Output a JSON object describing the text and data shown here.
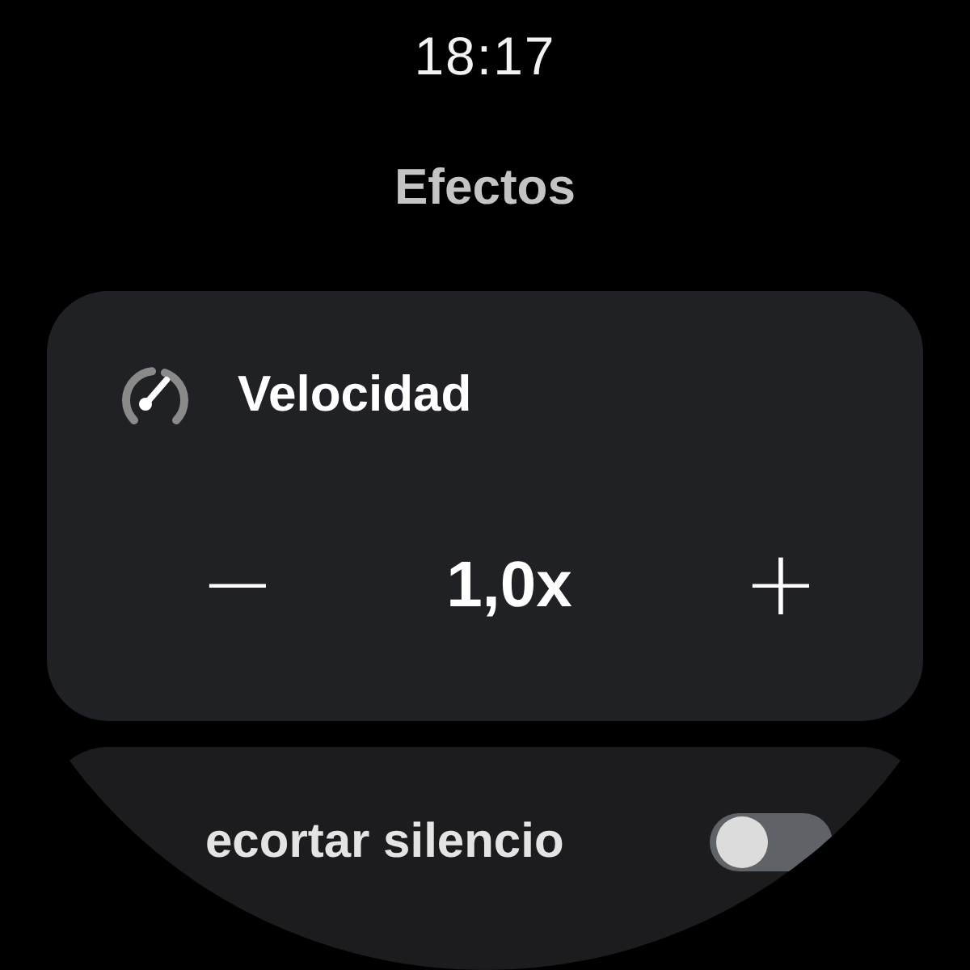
{
  "status_bar": {
    "time": "18:17"
  },
  "screen_title": "Efectos",
  "speed_card": {
    "title": "Velocidad",
    "value": "1,0x",
    "decrease": "−",
    "increase": "+"
  },
  "silence_row": {
    "label": "ecortar silencio",
    "on": false
  }
}
